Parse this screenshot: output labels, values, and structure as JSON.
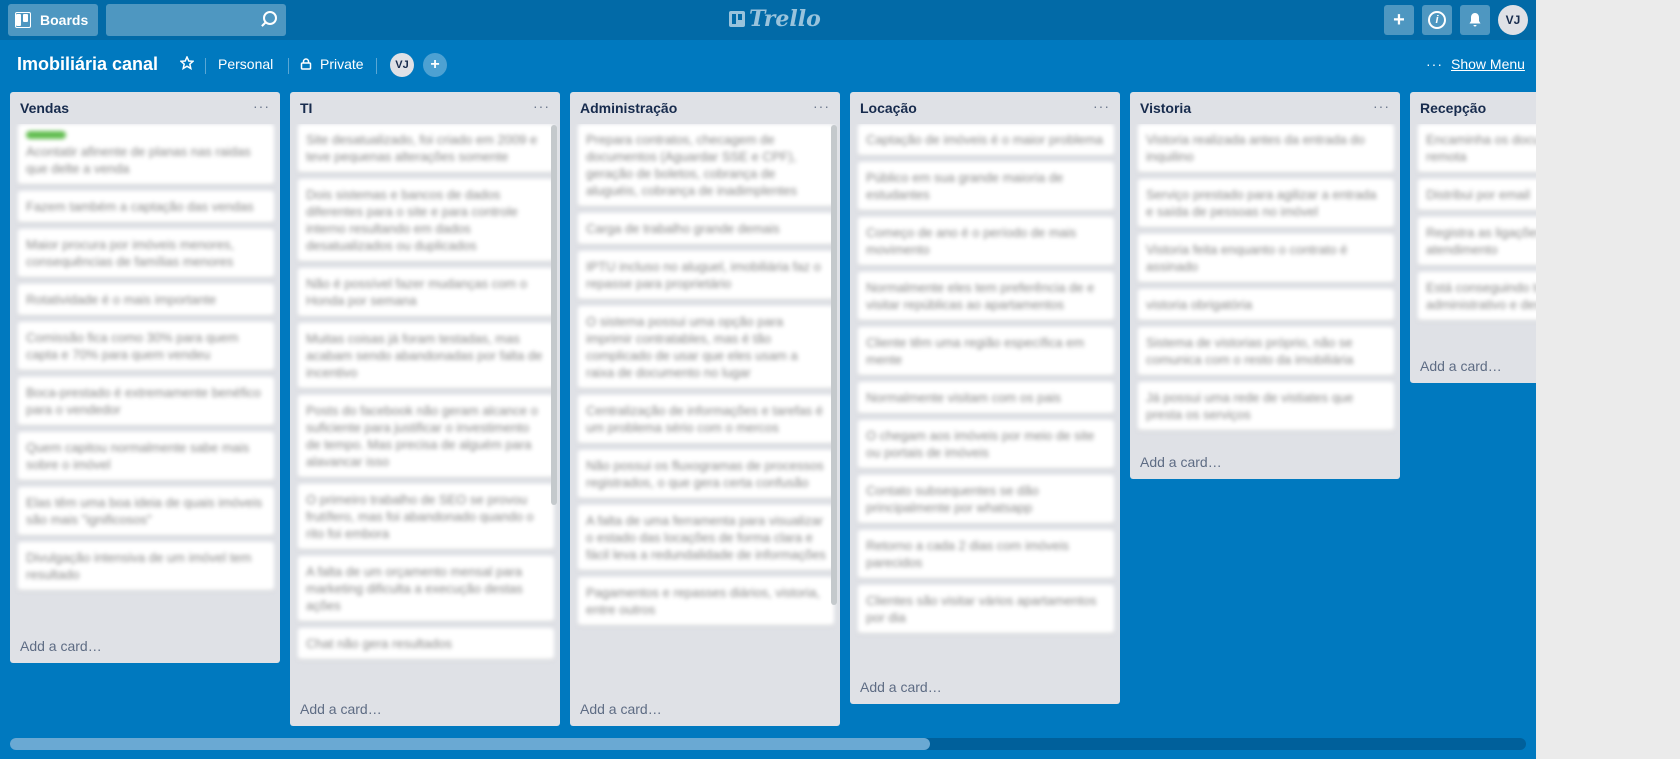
{
  "topbar": {
    "boards_label": "Boards",
    "search_placeholder": "",
    "logo_text": "Trello",
    "plus_icon": "plus-icon",
    "info_icon": "info-icon",
    "bell_icon": "bell-icon",
    "user_initials": "VJ"
  },
  "header": {
    "title": "Imobiliária canal",
    "personal_label": "Personal",
    "private_label": "Private",
    "member_initials": "VJ",
    "show_menu_label": "Show Menu"
  },
  "lists": [
    {
      "title": "Vendas",
      "add_card": "Add a card…",
      "cards": [
        "Acontatir afinente de planas nas raidas que delte a venda",
        "Fazem também a captação das vendas",
        "Maior procura por imóveis menores, consequências de famílias menores",
        "Rotatividade é o mais importante",
        "Comissão fica como 30% para quem capta e 70% para quem vendeu",
        "Boca-prestado é extremamente benéfico para o vendedor",
        "Quem capitou normalmente sabe mais sobre o imóvel",
        "Elas têm uma boa ideia de quais imóveis são mais \"ignificosos\"",
        "Divulgação intensiva de um imóvel tem resultado"
      ]
    },
    {
      "title": "TI",
      "add_card": "Add a card…",
      "cards": [
        "Site desatualizado, foi criado em 2009 e teve pequenas alterações somente",
        "Dois sistemas e bancos de dados diferentes para o site e para controle interno resultando em dados desatualizados ou duplicados",
        "Não é possível fazer mudanças com o Honda por semana",
        "Muitas coisas já foram testadas, mas acabam sendo abandonadas por falta de incentivo",
        "Posts do facebook não geram alcance o suficiente para justificar o investimento de tempo. Mas precisa de alguém para alavancar isso",
        "O primeiro trabalho de SEO se provou frutífero, mas foi abandonado quando o rito foi embora",
        "A falta de um orçamento mensal para marketing dificulta a execução destas ações",
        "Chat não gera resultados"
      ]
    },
    {
      "title": "Administração",
      "add_card": "Add a card…",
      "cards": [
        "Prepara contratos, checagem de documentos (Aguardar SSE e CPF), geração de boletos, cobrança de aluguéis, cobrança de inadimplentes",
        "Carga de trabalho grande demais",
        "IPTU incluso no aluguel, imobiliária faz o repasse para proprietário",
        "O sistema possui uma opção para imprimir contratables, mas é tão complicado de usar que eles usam a raixa de documento no lugar",
        "Centralização de informações e tarefas é um problema sério com o mercos",
        "Não possui os fluxogramas de processos registrados, o que gera certa confusão",
        "A falta de uma ferramenta para visualizar o estado das locações de forma clara e fácil leva a redundalidade de informações",
        "Pagamentos e repasses diários, vistoria, entre outros"
      ]
    },
    {
      "title": "Locação",
      "add_card": "Add a card…",
      "cards": [
        "Captação de imóveis é o maior problema",
        "Público em sua grande maioria de estudantes",
        "Começo de ano é o período de mais movimento",
        "Normalmente eles tem preferência de e visitar repúblicas ao apartamentos",
        "Cliente têm uma região específica em mente",
        "Normalmente visitam com os pais",
        "O chegam aos imóveis por meio de site ou portais de imóveis",
        "Contato subsequentes se dão principalmente por whatsapp",
        "Retorno a cada 2 dias com imóveis parecidos",
        "Clientes são visitar vários apartamentos por dia"
      ]
    },
    {
      "title": "Vistoria",
      "add_card": "Add a card…",
      "cards": [
        "Vistoria realizada antes da entrada do inquilino",
        "Serviço prestado para agilizar a entrada e saída de pessoas no imóvel",
        "Vistoria feita enquanto o contrato é assinado",
        "vistoria obrigatória",
        "Sistema de vistorias próprio, não se comunica com o resto da imobiliária",
        "Já possui uma rede de vistiates que presta os serviços"
      ]
    },
    {
      "title": "Recepção",
      "add_card": "Add a card…",
      "cards": [
        "Encaminha os documentos de locação-remota",
        "Distribui por email",
        "Registra as ligações e visitas de atendimento",
        "Está conseguindo trabalho do administrativo e desafogar"
      ]
    }
  ]
}
